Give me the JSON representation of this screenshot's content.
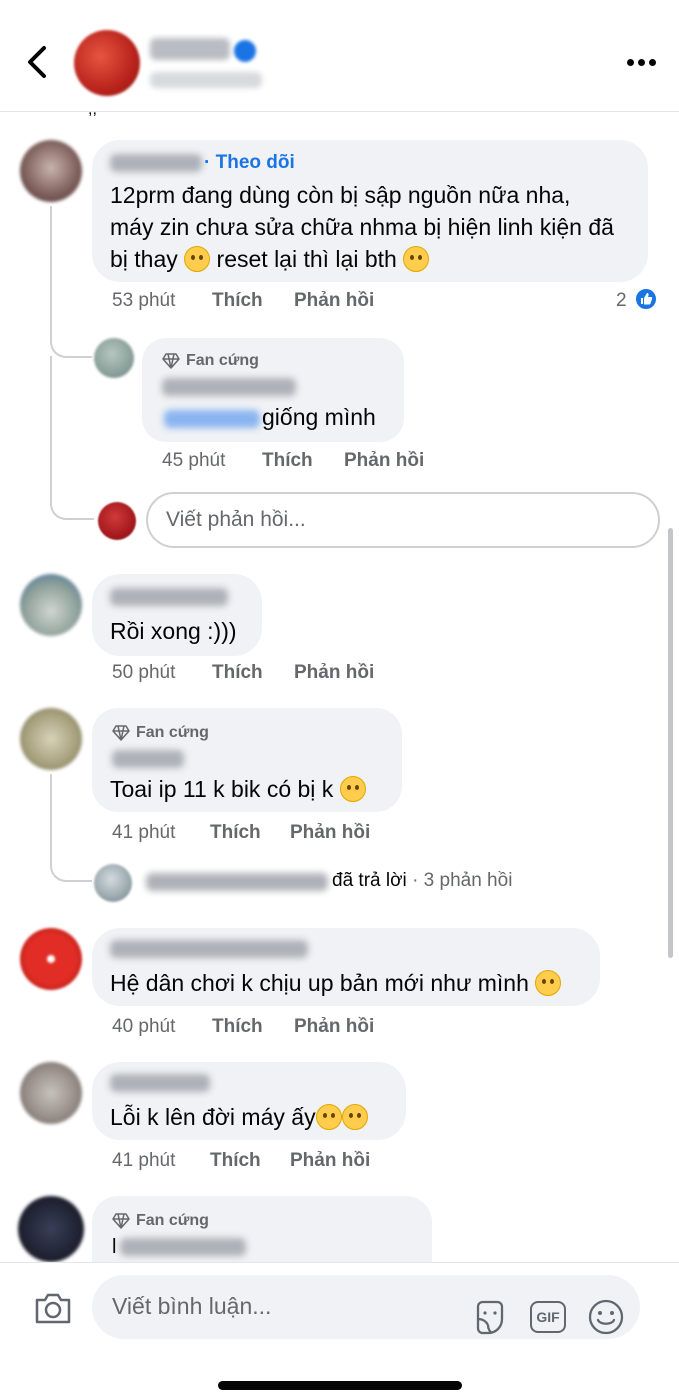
{
  "header": {
    "back_icon": "chevron-left-icon",
    "more_icon": "more-horizontal-icon",
    "verified_icon": "verified-badge-icon"
  },
  "colors": {
    "accent": "#1b74e4",
    "bubble": "#f0f2f5",
    "meta": "#65676b"
  },
  "comments": [
    {
      "follow_label": "· Theo dõi",
      "lines": [
        "12prm đang dùng còn bị sập nguồn nữa nha,",
        "máy zin chưa sửa chữa nhma bị hiện linh kiện đã",
        "bị thay",
        "reset lại thì lại bth"
      ],
      "time": "53 phút",
      "like": "Thích",
      "reply": "Phản hồi",
      "reaction_count": "2",
      "replies": [
        {
          "badge": "Fan cứng",
          "text": "giống mình",
          "time": "45 phút",
          "like": "Thích",
          "reply": "Phản hồi"
        }
      ],
      "reply_placeholder": "Viết phản hồi..."
    },
    {
      "text": "Rồi xong :)))",
      "time": "50 phút",
      "like": "Thích",
      "reply": "Phản hồi"
    },
    {
      "badge": "Fan cứng",
      "text": "Toai ip 11 k bik có bị k",
      "time": "41 phút",
      "like": "Thích",
      "reply": "Phản hồi",
      "replied_text": "đã trả lời",
      "reply_count": "· 3 phản hồi"
    },
    {
      "text": "Hệ dân chơi k chịu up bản mới như mình",
      "time": "40 phút",
      "like": "Thích",
      "reply": "Phản hồi"
    },
    {
      "text": "Lỗi k lên đời máy ấy",
      "time": "41 phút",
      "like": "Thích",
      "reply": "Phản hồi"
    },
    {
      "badge": "Fan cứng",
      "text": "l"
    }
  ],
  "footer": {
    "placeholder": "Viết bình luận...",
    "camera_icon": "camera-icon",
    "sticker_icon": "sticker-icon",
    "gif_label": "GIF",
    "emoji_icon": "emoji-icon"
  }
}
